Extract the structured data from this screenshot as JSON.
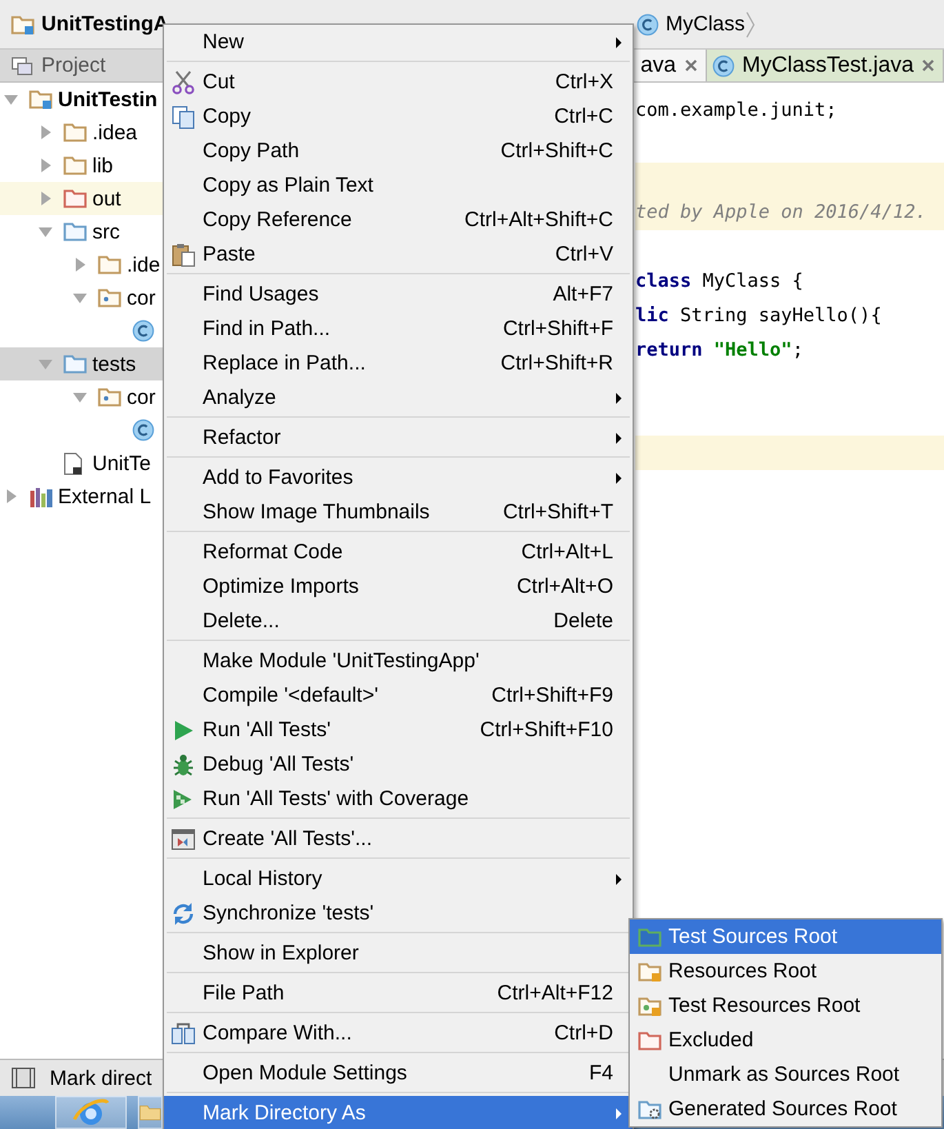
{
  "breadcrumbs": [
    {
      "label": "UnitTestingA",
      "kind": "module"
    },
    {
      "label": "MyClass",
      "kind": "class"
    }
  ],
  "tool_window": {
    "title": "Project"
  },
  "tree": [
    {
      "label": "UnitTestin",
      "kind": "module",
      "expanded": true,
      "selected": false,
      "children": [
        {
          "label": ".idea",
          "kind": "folder",
          "expanded": false,
          "selected": false
        },
        {
          "label": "lib",
          "kind": "folder",
          "expanded": false,
          "selected": false
        },
        {
          "label": "out",
          "kind": "excluded",
          "expanded": false,
          "selected": false,
          "highlighted": true
        },
        {
          "label": "src",
          "kind": "source",
          "expanded": true,
          "selected": false,
          "children": [
            {
              "label": ".ide",
              "kind": "folder",
              "expanded": false,
              "selected": false
            },
            {
              "label": "cor",
              "kind": "package",
              "expanded": true,
              "selected": false,
              "children": [
                {
                  "kind": "class",
                  "selected": false
                }
              ]
            }
          ]
        },
        {
          "label": "tests",
          "kind": "source",
          "expanded": true,
          "selected": true,
          "children": [
            {
              "label": "cor",
              "kind": "package",
              "expanded": true,
              "selected": false,
              "children": [
                {
                  "kind": "class",
                  "selected": false
                }
              ]
            }
          ]
        },
        {
          "label": "UnitTe",
          "kind": "file",
          "selected": false
        }
      ]
    },
    {
      "label": "External L",
      "kind": "library",
      "expanded": false,
      "selected": false
    }
  ],
  "editor": {
    "tabs": [
      {
        "label": "ava",
        "selected": true
      },
      {
        "label": "MyClassTest.java",
        "selected": false
      }
    ],
    "lines": [
      {
        "highlighted": false,
        "parts": [
          {
            "text": "com.example.junit;",
            "kind": "plain"
          }
        ]
      },
      {
        "highlighted": false
      },
      {
        "highlighted": true
      },
      {
        "highlighted": true,
        "parts": [
          {
            "text": "ted by Apple on 2016/4/12.",
            "kind": "comment"
          }
        ]
      },
      {
        "highlighted": false
      },
      {
        "highlighted": false,
        "parts": [
          {
            "text": "class",
            "kind": "keyword"
          },
          {
            "text": " MyClass {",
            "kind": "plain"
          }
        ]
      },
      {
        "highlighted": false,
        "parts": [
          {
            "text": "lic",
            "kind": "keyword"
          },
          {
            "text": " String sayHello(){",
            "kind": "plain"
          }
        ]
      },
      {
        "highlighted": false,
        "parts": [
          {
            "text": "return",
            "kind": "keyword"
          },
          {
            "text": " \"Hello\"",
            "kind": "string"
          },
          {
            "text": ";",
            "kind": "plain"
          }
        ]
      },
      {
        "highlighted": false
      },
      {
        "highlighted": false
      },
      {
        "highlighted": true
      }
    ]
  },
  "status": {
    "label": "Mark direct"
  },
  "menu": {
    "groups": [
      [
        {
          "label": "New",
          "submenu": true,
          "selected": false
        }
      ],
      [
        {
          "label": "Cut",
          "shortcut": "Ctrl+X",
          "kind": "cut",
          "selected": false
        },
        {
          "label": "Copy",
          "shortcut": "Ctrl+C",
          "kind": "copy",
          "selected": false
        },
        {
          "label": "Copy Path",
          "shortcut": "Ctrl+Shift+C",
          "selected": false
        },
        {
          "label": "Copy as Plain Text",
          "selected": false
        },
        {
          "label": "Copy Reference",
          "shortcut": "Ctrl+Alt+Shift+C",
          "selected": false
        },
        {
          "label": "Paste",
          "shortcut": "Ctrl+V",
          "kind": "paste",
          "selected": false
        }
      ],
      [
        {
          "label": "Find Usages",
          "shortcut": "Alt+F7",
          "selected": false
        },
        {
          "label": "Find in Path...",
          "shortcut": "Ctrl+Shift+F",
          "selected": false
        },
        {
          "label": "Replace in Path...",
          "shortcut": "Ctrl+Shift+R",
          "selected": false
        },
        {
          "label": "Analyze",
          "submenu": true,
          "selected": false
        }
      ],
      [
        {
          "label": "Refactor",
          "submenu": true,
          "selected": false
        }
      ],
      [
        {
          "label": "Add to Favorites",
          "submenu": true,
          "selected": false
        },
        {
          "label": "Show Image Thumbnails",
          "shortcut": "Ctrl+Shift+T",
          "selected": false
        }
      ],
      [
        {
          "label": "Reformat Code",
          "shortcut": "Ctrl+Alt+L",
          "selected": false
        },
        {
          "label": "Optimize Imports",
          "shortcut": "Ctrl+Alt+O",
          "selected": false
        },
        {
          "label": "Delete...",
          "shortcut": "Delete",
          "selected": false
        }
      ],
      [
        {
          "label": "Make Module 'UnitTestingApp'",
          "selected": false
        },
        {
          "label": "Compile '<default>'",
          "shortcut": "Ctrl+Shift+F9",
          "selected": false
        },
        {
          "label": "Run 'All Tests'",
          "shortcut": "Ctrl+Shift+F10",
          "kind": "run",
          "selected": false
        },
        {
          "label": "Debug 'All Tests'",
          "kind": "debug",
          "selected": false
        },
        {
          "label": "Run 'All Tests' with Coverage",
          "kind": "coverage",
          "selected": false
        }
      ],
      [
        {
          "label": "Create 'All Tests'...",
          "kind": "create",
          "selected": false
        }
      ],
      [
        {
          "label": "Local History",
          "submenu": true,
          "selected": false
        },
        {
          "label": "Synchronize 'tests'",
          "kind": "sync",
          "selected": false
        }
      ],
      [
        {
          "label": "Show in Explorer",
          "selected": false
        }
      ],
      [
        {
          "label": "File Path",
          "shortcut": "Ctrl+Alt+F12",
          "selected": false
        }
      ],
      [
        {
          "label": "Compare With...",
          "shortcut": "Ctrl+D",
          "kind": "compare",
          "selected": false
        }
      ],
      [
        {
          "label": "Open Module Settings",
          "shortcut": "F4",
          "selected": false
        }
      ],
      [
        {
          "label": "Mark Directory As",
          "submenu": true,
          "selected": true
        }
      ]
    ]
  },
  "submenu": {
    "groups": [
      [
        {
          "label": "Test Sources Root",
          "kind": "test-root",
          "selected": true
        },
        {
          "label": "Resources Root",
          "kind": "resources",
          "selected": false
        },
        {
          "label": "Test Resources Root",
          "kind": "test-resources",
          "selected": false
        },
        {
          "label": "Excluded",
          "kind": "excluded",
          "selected": false
        },
        {
          "label": "Unmark as Sources Root",
          "selected": false
        },
        {
          "label": "Generated Sources Root",
          "kind": "generated",
          "selected": false
        }
      ]
    ]
  }
}
